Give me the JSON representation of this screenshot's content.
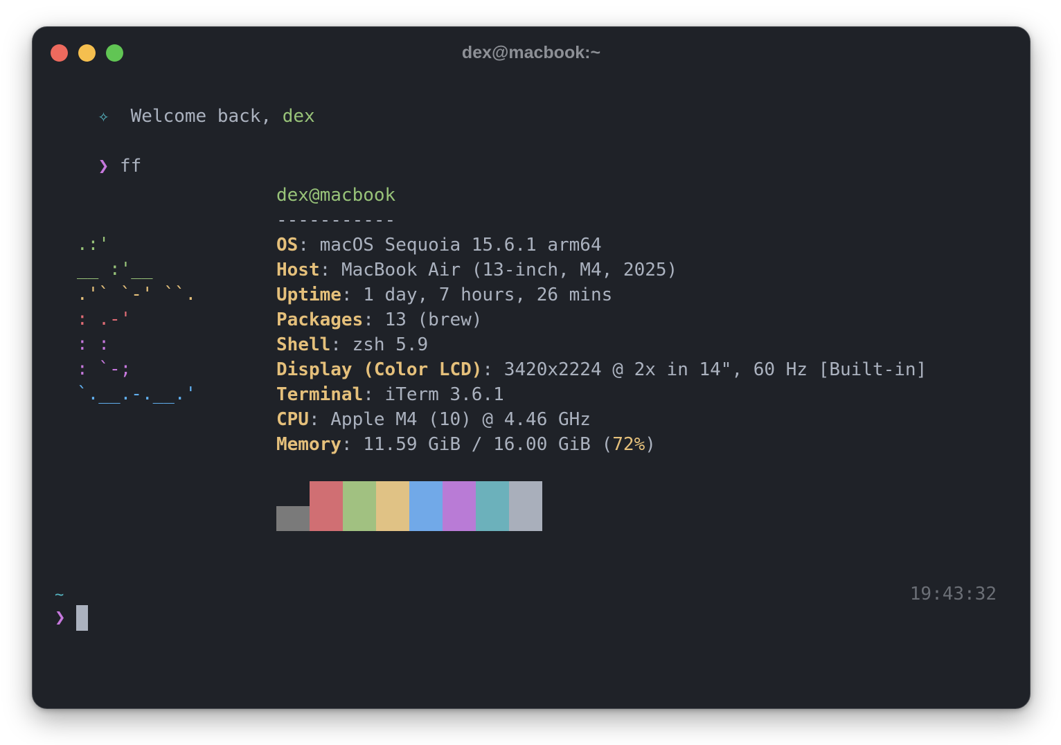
{
  "window": {
    "title": "dex@macbook:~",
    "traffic_lights": {
      "close": "#ed6a5e",
      "minimize": "#f5bf4f",
      "zoom": "#61c554"
    }
  },
  "greeting": {
    "icon": "sparkle-icon",
    "text": "Welcome back, ",
    "user": "dex"
  },
  "command": {
    "prompt_symbol": "❯",
    "text": "ff"
  },
  "fetch": {
    "user_host": "dex@macbook",
    "divider": "-----------",
    "rows": [
      {
        "key": "OS",
        "value": "macOS Sequoia 15.6.1 arm64"
      },
      {
        "key": "Host",
        "value": "MacBook Air (13-inch, M4, 2025)"
      },
      {
        "key": "Uptime",
        "value": "1 day, 7 hours, 26 mins"
      },
      {
        "key": "Packages",
        "value": "13 (brew)"
      },
      {
        "key": "Shell",
        "value": "zsh 5.9"
      },
      {
        "key": "Display (Color LCD)",
        "value": "3420x2224 @ 2x in 14\", 60 Hz [Built-in]"
      },
      {
        "key": "Terminal",
        "value": "iTerm 3.6.1"
      },
      {
        "key": "CPU",
        "value": "Apple M4 (10) @ 4.46 GHz"
      },
      {
        "key": "Memory",
        "value": "11.59 GiB / 16.00 GiB (",
        "highlight": "72%",
        "suffix": ")"
      }
    ],
    "palette": {
      "row1": [
        "#1f2228",
        "#d06f73",
        "#a1c181",
        "#e0c285",
        "#71a9e8",
        "#b97bd6",
        "#6cb1bb",
        "#a9afbb"
      ],
      "row2": [
        "#7a7a7a",
        "#d06f73",
        "#a1c181",
        "#e0c285",
        "#71a9e8",
        "#b97bd6",
        "#6cb1bb",
        "#a9afbb"
      ]
    }
  },
  "logo": {
    "icon": "apple-ascii-logo",
    "lines": [
      {
        "text": "        .:'",
        "color": "#98c379"
      },
      {
        "text": "    __ :'__",
        "color": "#98c379"
      },
      {
        "text": " .'`  `-'  ``.",
        "color": "#e5c07b"
      },
      {
        "text": ":          .-'",
        "color": "#e06c75"
      },
      {
        "text": ":         :",
        "color": "#c678dd"
      },
      {
        "text": " :         `-;",
        "color": "#c678dd"
      },
      {
        "text": "  `.__.-.__.'",
        "color": "#61afef"
      }
    ]
  },
  "prompt2": {
    "cwd": "~",
    "symbol": "❯",
    "clock": "19:43:32"
  },
  "colors": {
    "background": "#1f2228",
    "text": "#abb2bf",
    "green": "#98c379",
    "yellow": "#e5c07b",
    "purple": "#c678dd",
    "cyan": "#56b6c2"
  }
}
